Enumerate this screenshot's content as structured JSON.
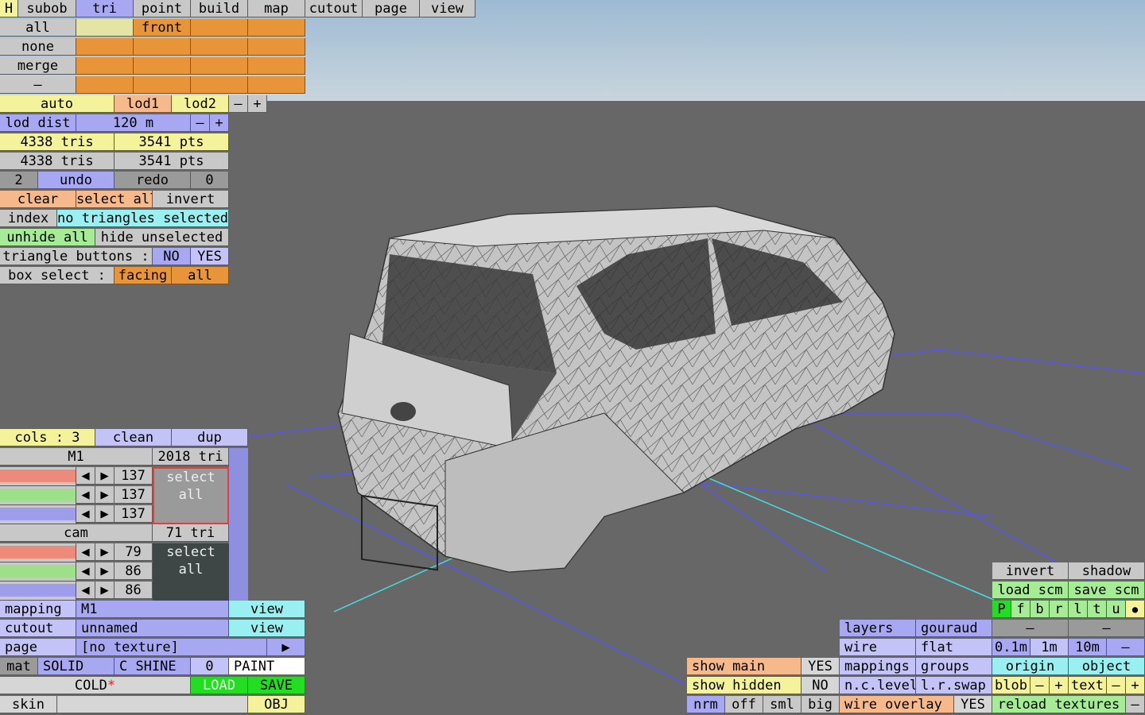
{
  "menu": {
    "h": "H",
    "tabs": [
      "subob",
      "tri",
      "point",
      "build",
      "map",
      "cutout",
      "page",
      "view"
    ]
  },
  "sel": {
    "all": "all",
    "front": "front",
    "none": "none",
    "merge": "merge",
    "dash": "–"
  },
  "lod": {
    "auto": "auto",
    "lod1": "lod1",
    "lod2": "lod2",
    "minus": "–",
    "plus": "+",
    "dist_label": "lod dist",
    "dist_value": "120 m"
  },
  "stats": {
    "tris1": "4338 tris",
    "pts1": "3541 pts",
    "tris2": "4338 tris",
    "pts2": "3541 pts"
  },
  "undo": {
    "count": "2",
    "undo": "undo",
    "redo": "redo",
    "redo_count": "0"
  },
  "tri": {
    "clear": "clear",
    "select_all": "select all",
    "invert": "invert",
    "index": "index",
    "status": "no triangles selected",
    "unhide": "unhide all",
    "hide_unsel": "hide unselected",
    "tb_label": "triangle buttons :",
    "no": "NO",
    "yes": "YES",
    "box_label": "box select :",
    "facing": "facing",
    "all": "all"
  },
  "cols": {
    "label": "cols : 3",
    "clean": "clean",
    "dup": "dup"
  },
  "m1": {
    "name": "M1",
    "tri": "2018 tri",
    "v1": "137",
    "v2": "137",
    "v3": "137",
    "select_all": "select all"
  },
  "cam": {
    "name": "cam",
    "tri": "71 tri",
    "v1": "79",
    "v2": "86",
    "v3": "86",
    "select_all": "select all"
  },
  "arrows": {
    "left": "◀",
    "right": "▶"
  },
  "map": {
    "mapping": "mapping",
    "m1": "M1",
    "view": "view",
    "cutout": "cutout",
    "unnamed": "unnamed",
    "view2": "view",
    "page": "page",
    "no_texture": "[no texture]",
    "play": "▶"
  },
  "matrow": {
    "mat": "mat",
    "solid": "SOLID",
    "cshine": "C SHINE",
    "zero": "0",
    "paint": "PAINT"
  },
  "coldrow": {
    "cold": "COLD",
    "star": "*",
    "load": "LOAD",
    "save": "SAVE"
  },
  "skinrow": {
    "skin": "skin",
    "obj": "OBJ"
  },
  "show": {
    "main": "show main",
    "main_val": "YES",
    "hidden": "show hidden",
    "hidden_val": "NO",
    "nrm": "nrm",
    "off": "off",
    "sml": "sml",
    "big": "big"
  },
  "render": {
    "layers": "layers",
    "gouraud": "gouraud",
    "wire": "wire",
    "flat": "flat",
    "mappings": "mappings",
    "groups": "groups",
    "nclevel": "n.c.level",
    "lrswap": "l.r.swap",
    "wire_overlay": "wire overlay",
    "overlay_val": "YES"
  },
  "right": {
    "invert": "invert",
    "shadow": "shadow",
    "load_scm": "load scm",
    "save_scm": "save scm",
    "letters": [
      "P",
      "f",
      "b",
      "r",
      "l",
      "t",
      "u"
    ],
    "dot": "●",
    "dash1": "–",
    "dash2": "–",
    "m01": "0.1m",
    "m1": "1m",
    "m10": "10m",
    "minus": "–",
    "origin": "origin",
    "object": "object",
    "blob": "blob",
    "text": "text",
    "reload": "reload textures"
  },
  "colors": {
    "sky_top": "#9dbad3",
    "sky_bottom": "#c7d4dc",
    "ground": "#676767",
    "grid": "#5555ee",
    "grid_hi": "#44dddd",
    "car": "#c9c9c9"
  }
}
